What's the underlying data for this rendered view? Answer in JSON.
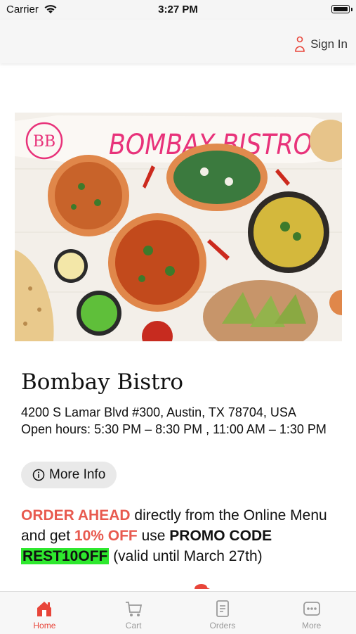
{
  "status_bar": {
    "carrier": "Carrier",
    "time": "3:27 PM"
  },
  "header": {
    "sign_in_label": "Sign In"
  },
  "hero": {
    "banner_title": "BOMBAY BISTRO",
    "logo_text": "BB"
  },
  "restaurant": {
    "name": "Bombay Bistro",
    "address": "4200 S Lamar Blvd #300, Austin, TX 78704, USA",
    "hours": "Open hours: 5:30 PM – 8:30 PM , 11:00 AM – 1:30 PM",
    "more_info_label": "More Info"
  },
  "promo": {
    "part1": "ORDER AHEAD",
    "part2": " directly from the Online Menu and get ",
    "part3": "10% OFF",
    "part4": " use ",
    "part5": "PROMO CODE",
    "code": "REST10OFF",
    "part6": " (valid until March 27th)"
  },
  "tabs": [
    {
      "label": "Home",
      "icon": "home-icon",
      "active": true
    },
    {
      "label": "Cart",
      "icon": "cart-icon",
      "active": false
    },
    {
      "label": "Orders",
      "icon": "orders-icon",
      "active": false
    },
    {
      "label": "More",
      "icon": "more-icon",
      "active": false
    }
  ],
  "colors": {
    "accent": "#e8453a",
    "promo_red": "#e85a4f",
    "code_highlight": "#2ee82e",
    "brand_pink": "#e8327a"
  }
}
